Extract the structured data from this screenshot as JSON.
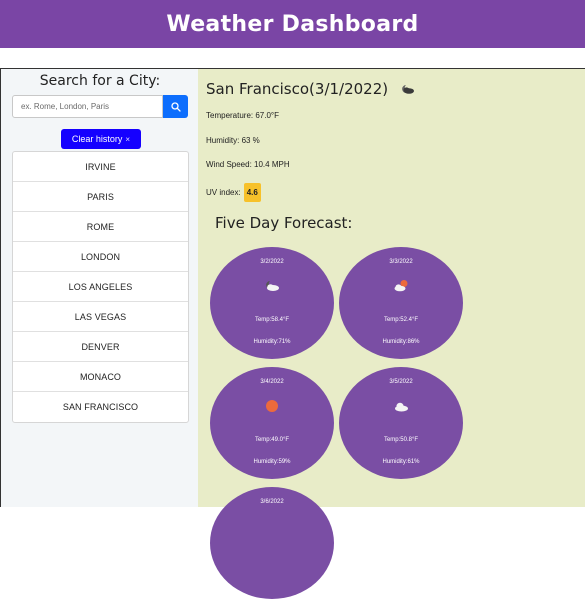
{
  "header": {
    "title": "Weather Dashboard"
  },
  "search": {
    "title": "Search for a City:",
    "placeholder": "ex. Rome, London, Paris",
    "clear_label": "Clear history",
    "clear_x": "×"
  },
  "history": [
    "IRVINE",
    "PARIS",
    "ROME",
    "LONDON",
    "LOS ANGELES",
    "LAS VEGAS",
    "DENVER",
    "MONACO",
    "SAN FRANCISCO"
  ],
  "current": {
    "city_date": "San Francisco(3/1/2022)",
    "icon": "cloudy-night-icon",
    "temperature": "Temperature: 67.0°F",
    "humidity": "Humidity: 63 %",
    "wind": "Wind Speed: 10.4 MPH",
    "uv_label": "UV index:",
    "uv_value": "4.6",
    "uv_color": "#f7c12a"
  },
  "forecast": {
    "title": "Five Day Forecast:",
    "days": [
      {
        "date": "3/2/2022",
        "icon": "cloudy-night-icon",
        "temp": "Temp:58.4°F",
        "humidity": "Humidity:71%"
      },
      {
        "date": "3/3/2022",
        "icon": "partly-cloudy-icon",
        "temp": "Temp:52.4°F",
        "humidity": "Humidity:86%"
      },
      {
        "date": "3/4/2022",
        "icon": "sun-icon",
        "temp": "Temp:49.0°F",
        "humidity": "Humidity:59%"
      },
      {
        "date": "3/5/2022",
        "icon": "cloud-icon",
        "temp": "Temp:50.8°F",
        "humidity": "Humidity:61%"
      },
      {
        "date": "3/6/2022",
        "icon": "",
        "temp": "",
        "humidity": ""
      }
    ]
  },
  "colors": {
    "header": "#7a45a5",
    "card": "#7a4ea4",
    "panel_bg": "#e8ecc8",
    "accent": "#0d6efd"
  }
}
